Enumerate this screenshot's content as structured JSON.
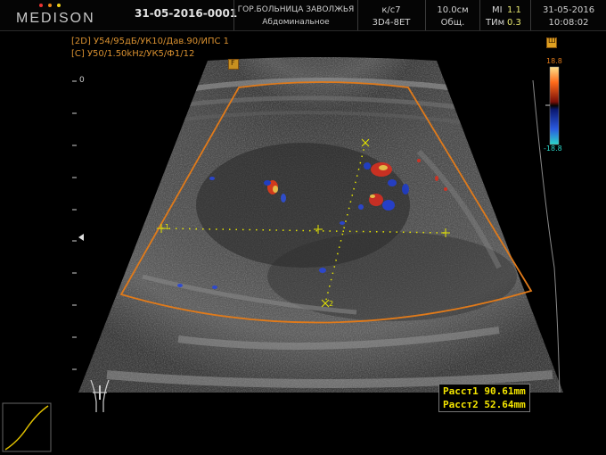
{
  "header": {
    "logo_text": "MEDISON",
    "exam_id": "31-05-2016-0001",
    "hospital": "ГОР.БОЛЬНИЦА ЗАВОЛЖЬЯ",
    "preset": "Абдоминальное",
    "frame_rate": "к/с7",
    "probe": "3D4-8ET",
    "depth": "10.0см",
    "depth_mode": "Общ.",
    "mi_label": "MI",
    "mi_value": "1.1",
    "tim_label": "ТИм",
    "tim_value": "0.3",
    "date": "31-05-2016",
    "time": "10:08:02"
  },
  "params": {
    "line_2d": "[2D] У54/95дБ/УК10/Дав.90/ИПС 1",
    "line_color": "[C] У50/1.50kHz/УК5/Ф1/12"
  },
  "colorbar": {
    "max_label": "18.8",
    "min_label": "-18.8"
  },
  "depth_scale": {
    "zero_label": "0"
  },
  "measurements": {
    "dist1": "Расст1 90.61mm",
    "dist2": "Расст2 52.64mm"
  },
  "markers": {
    "cursor1": "1",
    "cursor2": "2",
    "focus": "F",
    "probe_icon": "Ш"
  }
}
